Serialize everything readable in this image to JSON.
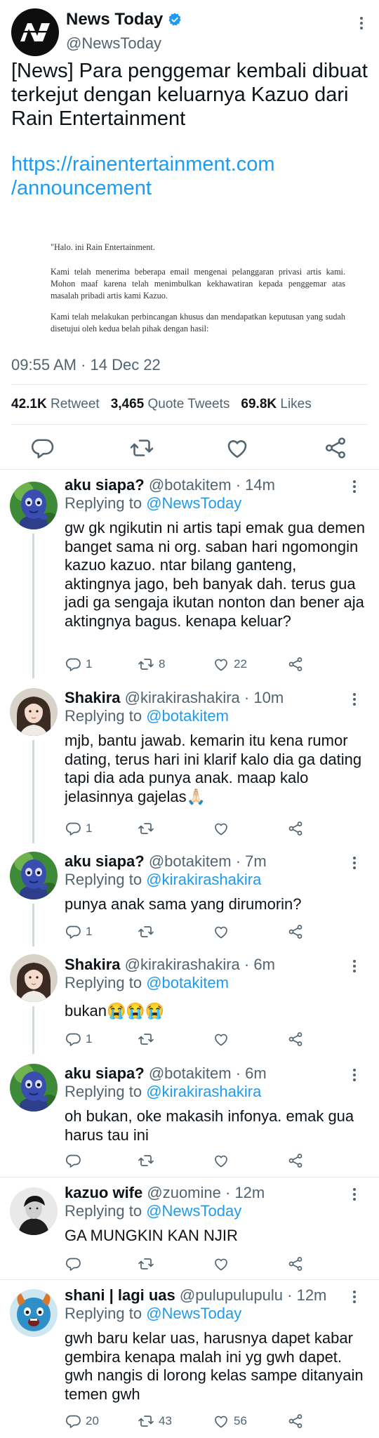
{
  "main": {
    "name": "News Today",
    "handle": "@NewsToday",
    "text": "[News] Para penggemar kembali dibuat terkejut dengan keluarnya Kazuo dari Rain Entertainment",
    "link_line1": "https://rainentertainment.com",
    "link_line2": "/announcement",
    "doc_p1": "\"Halo. ini Rain Entertainment.",
    "doc_p2": "Kami telah menerima beberapa email mengenai pelanggaran privasi artis kami. Mohon maaf karena telah menimbulkan kekhawatiran kepada penggemar atas masalah pribadi artis kami Kazuo.",
    "doc_p3": "Kami telah melakukan perbincangan khusus dan mendapatkan keputusan yang sudah disetujui oleh kedua belah pihak dengan hasil:",
    "timestamp": "09:55 AM · 14 Dec 22",
    "retweets": "42.1K",
    "retweets_label": "Retweet",
    "quotes": "3,465",
    "quotes_label": "Quote Tweets",
    "likes": "69.8K",
    "likes_label": "Likes"
  },
  "replying_label": "Replying to",
  "replies": [
    {
      "name": "aku siapa?",
      "handle": "@botakitem",
      "time": "· 14m",
      "to": "@NewsToday",
      "text": "gw gk ngikutin ni artis tapi emak gua demen banget sama ni org. saban hari ngomongin kazuo kazuo. ntar bilang ganteng, aktingnya jago, beh banyak dah. terus gua jadi ga sengaja ikutan nonton dan bener aja aktingnya bagus. kenapa keluar?",
      "replies": "1",
      "retweets": "8",
      "likes": "22"
    },
    {
      "name": "Shakira",
      "handle": "@kirakirashakira",
      "time": "· 10m",
      "to": "@botakitem",
      "text": "mjb, bantu jawab. kemarin itu kena rumor dating, terus hari ini klarif kalo dia ga dating tapi dia ada punya anak. maap kalo jelasinnya gajelas🙏🏻",
      "replies": "1",
      "retweets": "",
      "likes": ""
    },
    {
      "name": "aku siapa?",
      "handle": "@botakitem",
      "time": "· 7m",
      "to": "@kirakirashakira",
      "text": "punya anak sama yang dirumorin?",
      "replies": "1",
      "retweets": "",
      "likes": ""
    },
    {
      "name": "Shakira",
      "handle": "@kirakirashakira",
      "time": "· 6m",
      "to": "@botakitem",
      "text": "bukan😭😭😭",
      "replies": "1",
      "retweets": "",
      "likes": ""
    },
    {
      "name": "aku siapa?",
      "handle": "@botakitem",
      "time": "· 6m",
      "to": "@kirakirashakira",
      "text": "oh bukan, oke makasih infonya. emak gua harus tau ini",
      "replies": "",
      "retweets": "",
      "likes": ""
    },
    {
      "name": "kazuo wife",
      "handle": "@zuomine",
      "time": "· 12m",
      "to": "@NewsToday",
      "text": "GA MUNGKIN KAN NJIR",
      "replies": "",
      "retweets": "",
      "likes": ""
    },
    {
      "name": "shani | lagi uas",
      "handle": "@pulupulupulu",
      "time": "· 12m",
      "to": "@NewsToday",
      "text": "gwh baru kelar uas, harusnya dapet kabar gembira kenapa malah ini yg gwh dapet. gwh nangis di lorong kelas sampe ditanyain temen gwh",
      "replies": "20",
      "retweets": "43",
      "likes": "56"
    }
  ],
  "colors": {
    "link": "#1d9bf0",
    "secondary": "#536471",
    "text": "#0f1419",
    "divider": "#e6ecf0"
  }
}
